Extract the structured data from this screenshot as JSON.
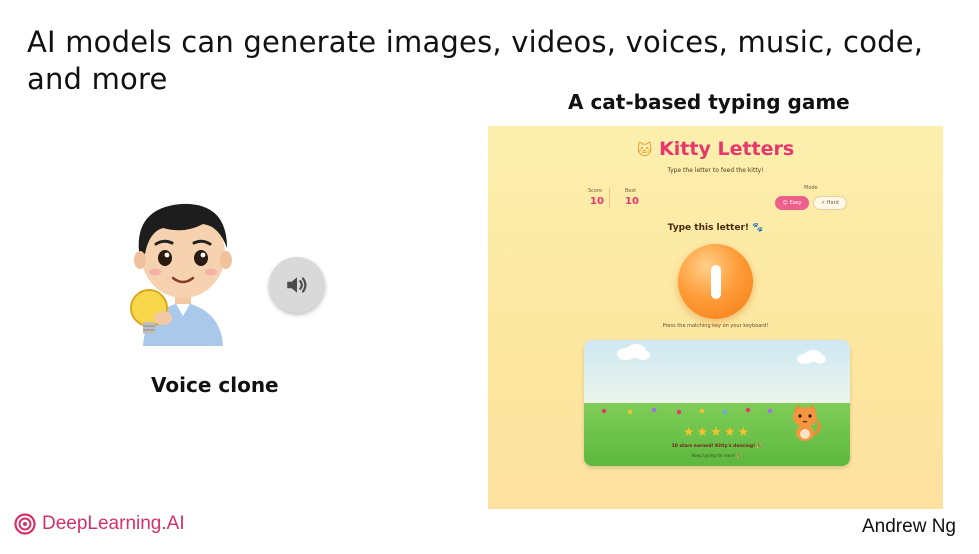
{
  "slide": {
    "title": "AI models can generate images, videos, voices, music, code, and more",
    "game_caption": "A cat-based typing game",
    "voice_label": "Voice clone",
    "footer_brand": "DeepLearning.AI",
    "footer_author": "Andrew Ng",
    "accent_color": "#d6306a"
  },
  "game": {
    "title": "Kitty Letters",
    "title_icon": "cat-face-icon",
    "subtitle": "Type the letter to feed the kitty!",
    "score_label": "Score",
    "score_value": "10",
    "best_label": "Best",
    "best_value": "10",
    "mode_label": "Mode",
    "easy_label": "Easy",
    "hard_label": "Hard",
    "prompt": "Type this letter! 🐾",
    "current_letter": "I",
    "hint": "Press the matching key on your keyboard!",
    "stars": "★★★★★",
    "message": "10 stars earned! Kitty's dancing! 🎉",
    "keep_going": "Keep typing for more! 🎉",
    "primary_color": "#e8366d"
  }
}
